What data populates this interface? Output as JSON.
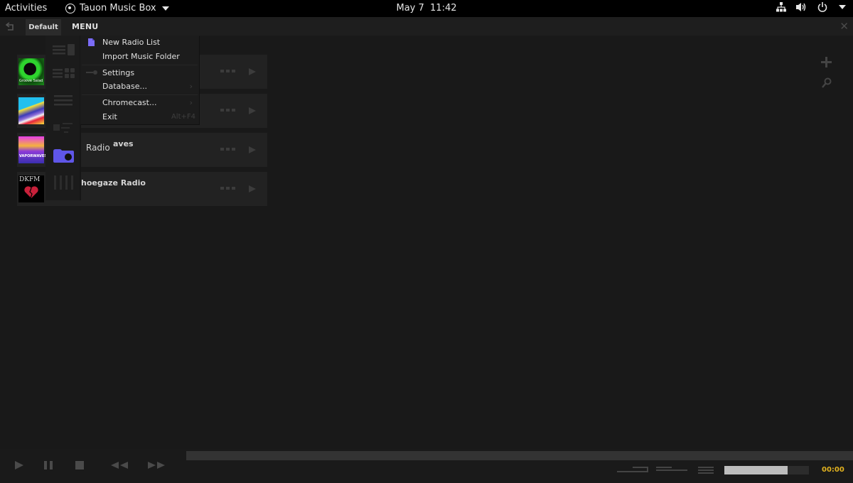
{
  "system_bar": {
    "activities": "Activities",
    "app_name": "Tauon Music Box",
    "date": "May 7",
    "time": "11:42",
    "tray_icons": [
      "network-icon",
      "volume-icon",
      "power-icon",
      "caret-down-icon"
    ]
  },
  "tab_bar": {
    "back_icon": "back-icon",
    "tabs": [
      {
        "label": "Default",
        "active": true
      }
    ],
    "menu_label": "MENU",
    "close_icon": "close-icon"
  },
  "menu": {
    "items": [
      {
        "label": "New Radio List",
        "icon": "file-icon",
        "icon_color": "#7b6cf6"
      },
      {
        "label": "Import Music Folder"
      },
      {
        "label": "Settings",
        "icon": "settings-icon"
      },
      {
        "label": "Database...",
        "submenu": "›"
      },
      {
        "label": "Chromecast...",
        "submenu": "›"
      },
      {
        "label": "Exit",
        "shortcut": "Alt+F4"
      }
    ]
  },
  "view_switcher": {
    "items": [
      {
        "icon": "list-with-art-icon"
      },
      {
        "icon": "gallery-grid-icon"
      },
      {
        "icon": "tracklist-icon"
      },
      {
        "icon": "minimal-view-icon"
      },
      {
        "icon": "radio-icon",
        "active": true,
        "color": "#5f56e8"
      },
      {
        "icon": "columns-icon"
      }
    ]
  },
  "radio_list": {
    "stations": [
      {
        "title": "",
        "art_label": "Groove Salad",
        "art_colors": [
          "#0c3a0c",
          "#2ed42e"
        ]
      },
      {
        "title": "",
        "art_label": "",
        "art_colors": [
          "#22c0ef",
          "#e8233c"
        ]
      },
      {
        "title_prefix": "Radio",
        "title": "aves",
        "art_label": "VAPORWAVES",
        "art_colors": [
          "#c43de8",
          "#f5b23f"
        ]
      },
      {
        "title": "hoegaze Radio",
        "art_label": "DKFM",
        "art_colors": [
          "#000000",
          "#c8203a"
        ]
      }
    ],
    "more_label": "•••",
    "play_icon": "play-icon"
  },
  "right_tools": {
    "add_icon": "add-icon",
    "search_icon": "search-icon"
  },
  "playback": {
    "controls": [
      "play-icon",
      "pause-icon",
      "stop-icon",
      "rewind-icon",
      "fast-forward-icon"
    ],
    "time": "00:00",
    "time_color": "#e2b21f",
    "volume_percent": 75,
    "seek_percent": 0,
    "mode_icons": [
      "mode-a-icon",
      "mode-b-icon",
      "playlist-icon"
    ]
  }
}
